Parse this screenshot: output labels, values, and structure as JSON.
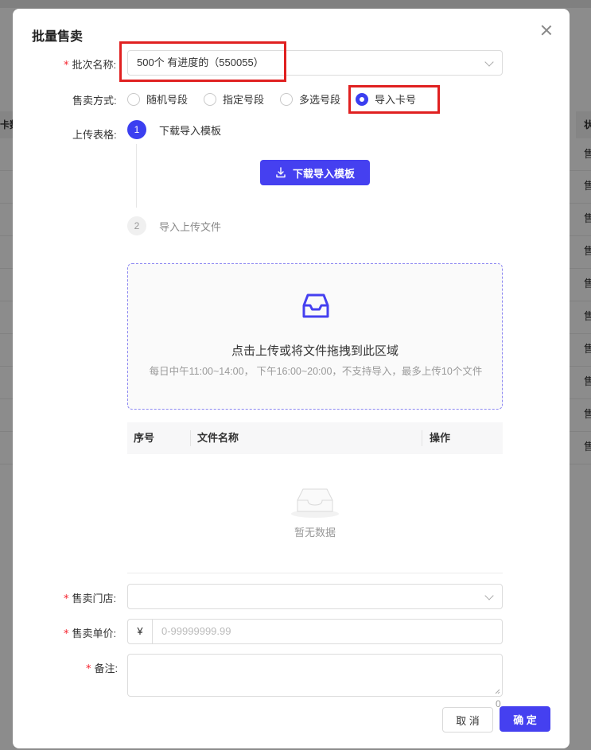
{
  "background": {
    "left_header_text": "卡数",
    "right_header_text": "状",
    "right_cells": [
      "售",
      "售",
      "售",
      "售",
      "售",
      "售",
      "售",
      "售",
      "售",
      "售"
    ]
  },
  "modal": {
    "title": "批量售卖",
    "batch_label": "批次名称",
    "batch_value": "500个 有进度的（550055）",
    "sale_method_label": "售卖方式",
    "sale_methods": [
      {
        "label": "随机号段",
        "checked": false
      },
      {
        "label": "指定号段",
        "checked": false
      },
      {
        "label": "多选号段",
        "checked": false
      },
      {
        "label": "导入卡号",
        "checked": true
      }
    ],
    "upload_table_label": "上传表格",
    "steps": [
      {
        "num": "1",
        "title": "下载导入模板",
        "state": "active"
      },
      {
        "num": "2",
        "title": "导入上传文件",
        "state": "idle"
      }
    ],
    "download_button_label": "下载导入模板",
    "upload": {
      "main_text": "点击上传或将文件拖拽到此区域",
      "hint_text": "每日中午11:00~14:00， 下午16:00~20:00，不支持导入，最多上传10个文件"
    },
    "file_table": {
      "columns": [
        "序号",
        "文件名称",
        "操作"
      ],
      "empty_text": "暂无数据"
    },
    "store_label": "售卖门店",
    "store_value": "",
    "price_label": "售卖单价",
    "price_prefix": "¥",
    "price_placeholder": "0-99999999.99",
    "remark_label": "备注",
    "remark_counter": "0",
    "cancel_label": "取 消",
    "confirm_label": "确 定",
    "label_colon": ":",
    "accent_color": "#4540f0",
    "highlight_color": "#e02020"
  }
}
